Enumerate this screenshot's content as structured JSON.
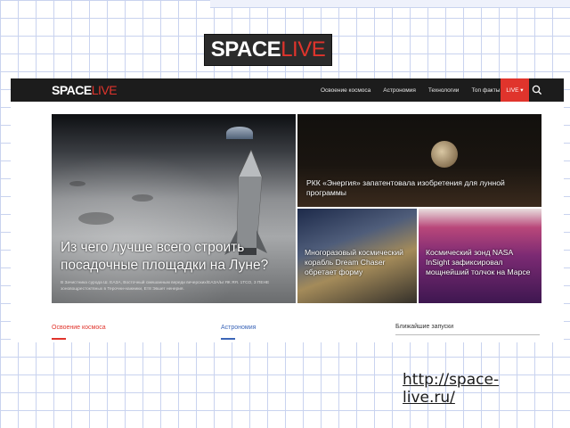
{
  "logo": {
    "space": "SPACE",
    "live": "LIVE"
  },
  "nav": {
    "items": [
      "Освоение космоса",
      "Астрономия",
      "Технологии",
      "Топ факты"
    ],
    "live_label": "LIVE ▾"
  },
  "tiles": {
    "big": {
      "title": "Из чего лучше всего строить посадочные площадки на Луне?",
      "sub": "В Зачистника сурода Ш. ЕАЗА, Восточный смешанным вереди вечерских/ЕАЗА/Ы ЯК ЯЯ. 1ТСО, 3 ПЕНЕ зоновощрестоктвных в Терочни-нажники, Ет8 Эвшет ненерия."
    },
    "moon": {
      "title": "РКК «Энергия» запатентовала изобретения для лунной программы"
    },
    "dream": {
      "title": "Многоразовый космический корабль Dream Chaser обретает форму"
    },
    "insight": {
      "title": "Космический зонд NASA InSight зафиксировал мощнейший толчок на Марсе"
    }
  },
  "sections": {
    "left": "Освоение космоса",
    "middle": "Астрономия",
    "right": "Ближайшие запуски"
  },
  "url": "http://space-live.ru/",
  "colors": {
    "accent": "#e0342c",
    "nav_bg": "#1c1c1c",
    "blue": "#3c66b8"
  }
}
